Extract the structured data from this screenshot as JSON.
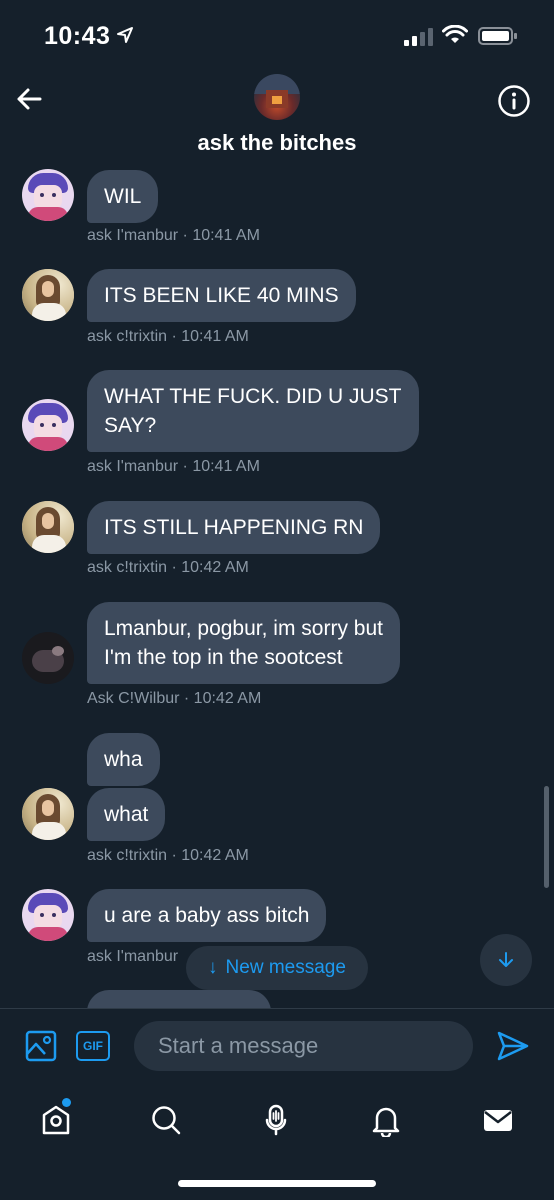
{
  "status_bar": {
    "time": "10:43"
  },
  "header": {
    "title": "ask the bitches"
  },
  "messages": [
    {
      "text": "WIL",
      "meta": "ask I'manbur · 10:41 AM"
    },
    {
      "text": "ITS BEEN LIKE 40 MINS",
      "meta": "ask c!trixtin · 10:41 AM"
    },
    {
      "text_lines": [
        "WHAT THE FUCK. DID U JUST",
        "SAY?"
      ],
      "meta": "ask I'manbur · 10:41 AM"
    },
    {
      "text": "ITS STILL HAPPENING RN",
      "meta": "ask c!trixtin · 10:42 AM"
    },
    {
      "text_lines": [
        "Lmanbur, pogbur, im sorry but",
        "I'm the top in the sootcest"
      ],
      "meta": "Ask C!Wilbur · 10:42 AM"
    },
    {
      "text_group": [
        "wha",
        "what"
      ],
      "meta": "ask c!trixtin · 10:42 AM"
    },
    {
      "text": "u are a baby ass bitch",
      "meta": "ask I'manbur"
    }
  ],
  "new_message_pill": {
    "arrow": "↓",
    "label": "New message"
  },
  "composer": {
    "placeholder": "Start a message",
    "gif_label": "GIF"
  },
  "tabbar": {
    "items": [
      "home-icon",
      "search-icon",
      "spaces-icon",
      "notifications-icon",
      "messages-icon"
    ]
  },
  "colors": {
    "background": "#15202b",
    "bubble": "#3d4a5c",
    "accent": "#1d9bf0",
    "meta_text": "#8b98a5"
  }
}
